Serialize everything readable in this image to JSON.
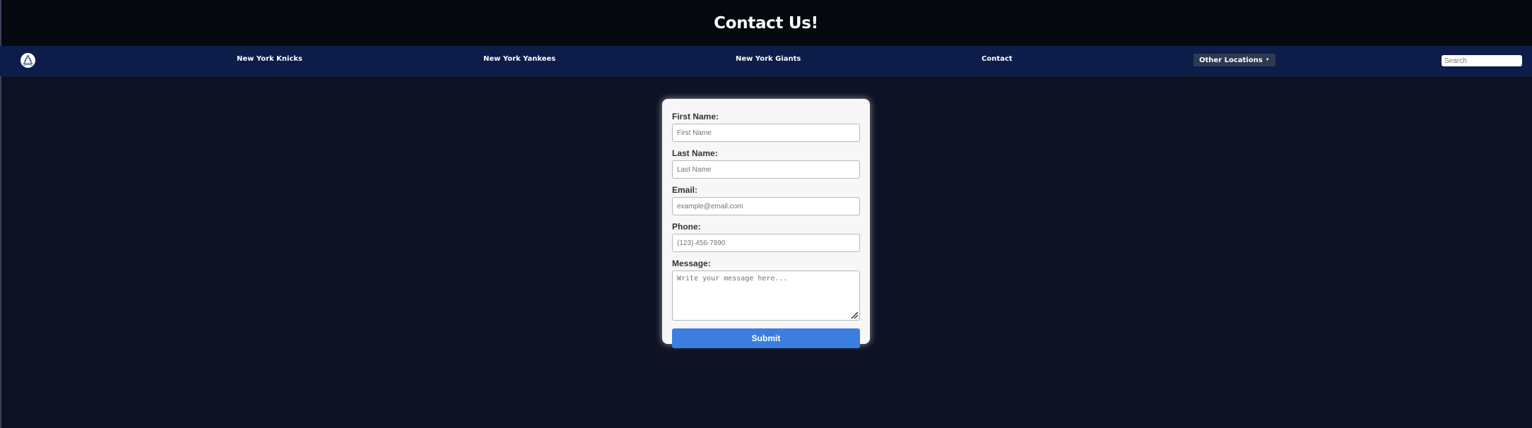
{
  "header": {
    "title": "Contact Us!"
  },
  "nav": {
    "logo_icon": "city-skyline-icon",
    "links": [
      "New York Knicks",
      "New York Yankees",
      "New York Giants",
      "Contact"
    ],
    "dropdown_label": "Other Locations",
    "search_placeholder": "Search"
  },
  "form": {
    "fields": [
      {
        "label": "First Name:",
        "placeholder": "First Name"
      },
      {
        "label": "Last Name:",
        "placeholder": "Last Name"
      },
      {
        "label": "Email:",
        "placeholder": "example@email.com"
      },
      {
        "label": "Phone:",
        "placeholder": "(123) 456-7890"
      }
    ],
    "message": {
      "label": "Message:",
      "placeholder": "Write your message here..."
    },
    "submit_label": "Submit"
  },
  "colors": {
    "page_background": "#0d1224",
    "header_background": "#05080f",
    "nav_background": "#0c1d4a",
    "submit_button": "#3b7ee0"
  }
}
